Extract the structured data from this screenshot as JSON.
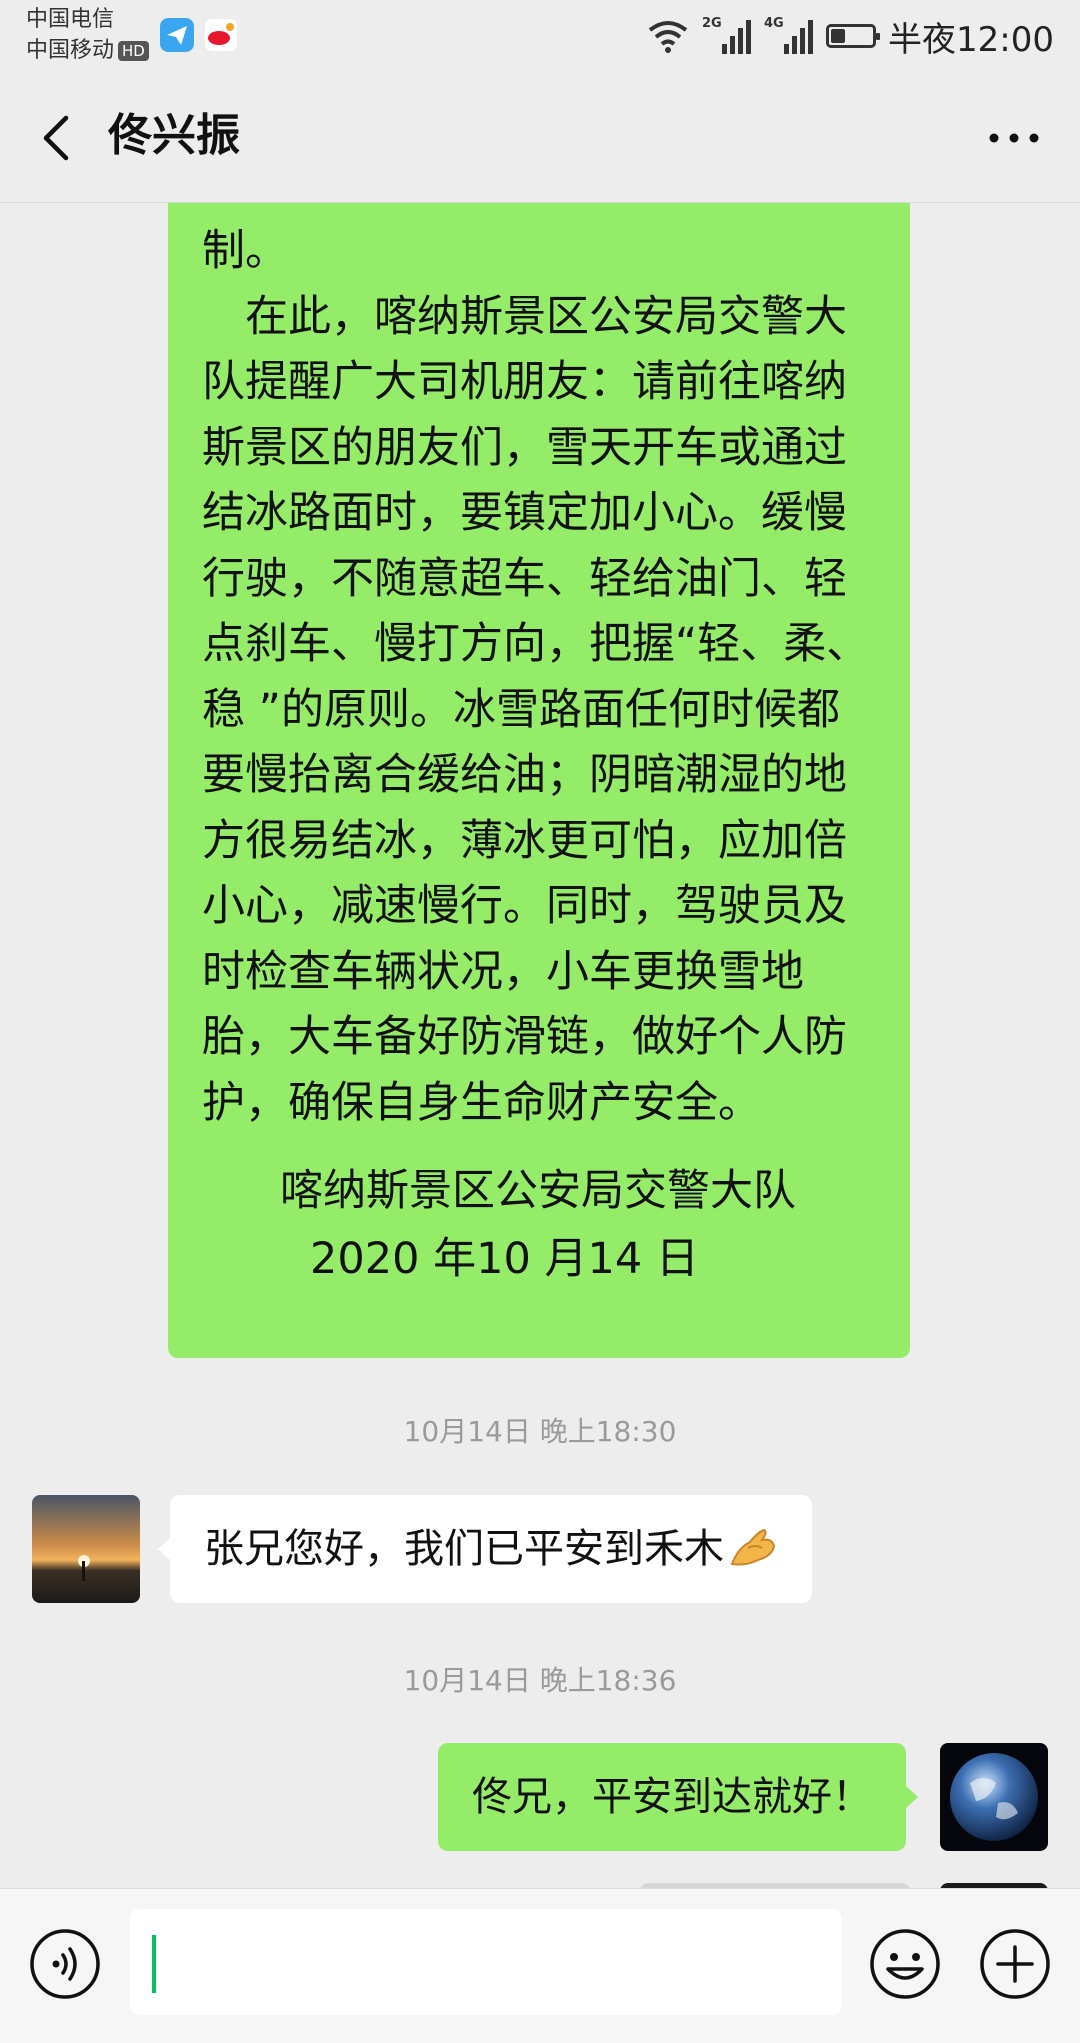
{
  "status_bar": {
    "carrier_1": "中国电信",
    "carrier_2": "中国移动",
    "hd_badge": "HD",
    "network_1": "2G",
    "network_2": "4G",
    "time": "半夜12:00",
    "battery_level": 0.35
  },
  "header": {
    "title": "佟兴振"
  },
  "messages": {
    "long_message_text": "制。\n　在此，喀纳斯景区公安局交警大\n队提醒广大司机朋友：请前往喀纳\n斯景区的朋友们，雪天开车或通过\n结冰路面时，要镇定加小心。缓慢\n行驶，不随意超车、轻给油门、轻\n点刹车、慢打方向，把握“轻、柔、\n稳 ”的原则。冰雪路面任何时候都\n要慢抬离合缓给油；阴暗潮湿的地\n方很易结冰，薄冰更可怕，应加倍\n小心，减速慢行。同时，驾驶员及\n时检查车辆状况，小车更换雪地\n胎，大车备好防滑链，做好个人防\n护，确保自身生命财产安全。",
    "signature_org": "喀纳斯景区公安局交警大队",
    "signature_date": "2020 年10 月14 日",
    "timestamp_1": "10月14日 晚上18:30",
    "incoming_text": "张兄您好，我们已平安到禾木",
    "timestamp_2": "10月14日 晚上18:36",
    "outgoing_text": "佟兄，平安到达就好！"
  },
  "input_bar": {
    "input_value": ""
  },
  "colors": {
    "sent_bubble": "#95ec69",
    "received_bubble": "#ffffff",
    "background": "#ededed",
    "caret": "#07c160"
  },
  "icons": {
    "back": "chevron-left-icon",
    "more": "more-dots-icon",
    "voice": "voice-icon",
    "emoji": "emoji-icon",
    "plus": "plus-icon",
    "thumbs": "ok-hand-emoji-icon"
  }
}
